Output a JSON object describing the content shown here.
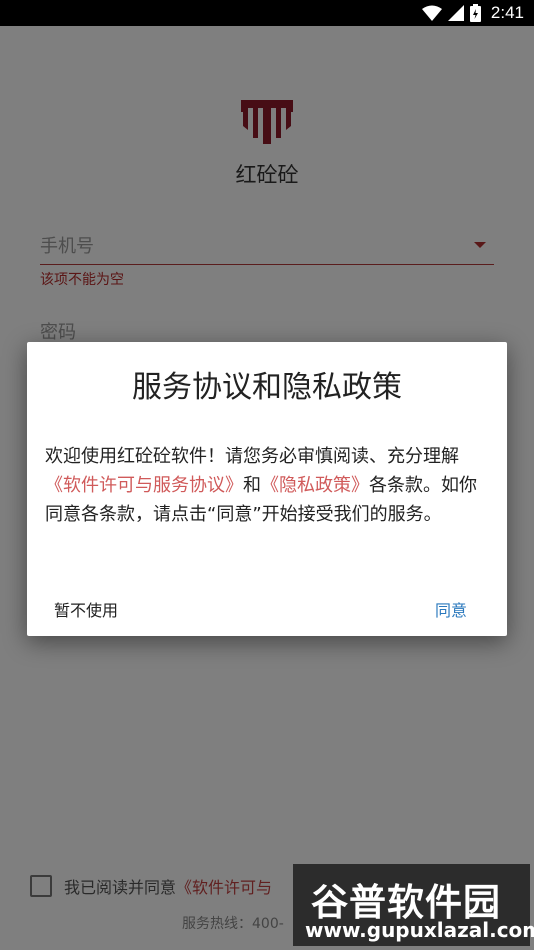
{
  "status_bar": {
    "time": "2:41",
    "icons": [
      "wifi-icon",
      "signal-icon",
      "battery-icon"
    ]
  },
  "app": {
    "name": "红砼砼",
    "logo": "app-logo"
  },
  "login": {
    "phone_placeholder": "手机号",
    "phone_error": "该项不能为空",
    "password_placeholder": "密码",
    "agree_text": "我已阅读并同意",
    "agree_link": "《软件许可与",
    "hotline": "服务热线：400-"
  },
  "dialog": {
    "title": "服务协议和隐私政策",
    "body_intro": "欢迎使用红砼砼软件！请您务必审慎阅读、充分理解",
    "link1": "《软件许可与服务协议》",
    "body_and": "和",
    "link2": "《隐私政策》",
    "body_rest": "各条款。如你同意各条款，请点击“同意”开始接受我们的服务。",
    "decline": "暂不使用",
    "accept": "同意"
  },
  "watermark": {
    "main": "谷普软件园",
    "url": "www.gupuxlazal.com"
  },
  "colors": {
    "accent": "#b72d2d",
    "link": "#d05a5a",
    "button": "#2a78bd",
    "logo": "#8f1b2a"
  }
}
